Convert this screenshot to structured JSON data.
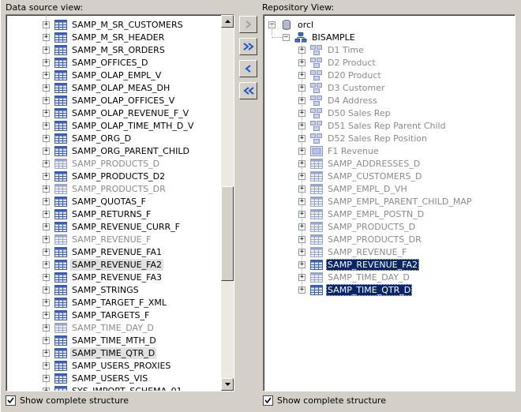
{
  "left_pane": {
    "title": "Data source view:",
    "items": [
      {
        "label": "SAMP_M_SR_CUSTOMERS",
        "style": "normal"
      },
      {
        "label": "SAMP_M_SR_HEADER",
        "style": "normal"
      },
      {
        "label": "SAMP_M_SR_ORDERS",
        "style": "normal"
      },
      {
        "label": "SAMP_OFFICES_D",
        "style": "normal"
      },
      {
        "label": "SAMP_OLAP_EMPL_V",
        "style": "normal"
      },
      {
        "label": "SAMP_OLAP_MEAS_DH",
        "style": "normal"
      },
      {
        "label": "SAMP_OLAP_OFFICES_V",
        "style": "normal"
      },
      {
        "label": "SAMP_OLAP_REVENUE_F_V",
        "style": "normal"
      },
      {
        "label": "SAMP_OLAP_TIME_MTH_D_V",
        "style": "normal"
      },
      {
        "label": "SAMP_ORG_D",
        "style": "normal"
      },
      {
        "label": "SAMP_ORG_PARENT_CHILD",
        "style": "normal"
      },
      {
        "label": "SAMP_PRODUCTS_D",
        "style": "dim"
      },
      {
        "label": "SAMP_PRODUCTS_D2",
        "style": "normal"
      },
      {
        "label": "SAMP_PRODUCTS_DR",
        "style": "dim"
      },
      {
        "label": "SAMP_QUOTAS_F",
        "style": "normal"
      },
      {
        "label": "SAMP_RETURNS_F",
        "style": "normal"
      },
      {
        "label": "SAMP_REVENUE_CURR_F",
        "style": "normal"
      },
      {
        "label": "SAMP_REVENUE_F",
        "style": "dim"
      },
      {
        "label": "SAMP_REVENUE_FA1",
        "style": "normal"
      },
      {
        "label": "SAMP_REVENUE_FA2",
        "style": "sel-grey"
      },
      {
        "label": "SAMP_REVENUE_FA3",
        "style": "normal"
      },
      {
        "label": "SAMP_STRINGS",
        "style": "normal"
      },
      {
        "label": "SAMP_TARGET_F_XML",
        "style": "normal"
      },
      {
        "label": "SAMP_TARGETS_F",
        "style": "normal"
      },
      {
        "label": "SAMP_TIME_DAY_D",
        "style": "dim"
      },
      {
        "label": "SAMP_TIME_MTH_D",
        "style": "normal"
      },
      {
        "label": "SAMP_TIME_QTR_D",
        "style": "sel-grey"
      },
      {
        "label": "SAMP_USERS_PROXIES",
        "style": "normal"
      },
      {
        "label": "SAMP_USERS_VIS",
        "style": "normal"
      },
      {
        "label": "SYS_IMPORT_SCHEMA_01",
        "style": "normal"
      }
    ],
    "scroll_position": 0.62
  },
  "right_pane": {
    "title": "Repository View:",
    "root": {
      "label": "orcl",
      "icon": "database-icon"
    },
    "schema": {
      "label": "BISAMPLE",
      "icon": "schema-icon"
    },
    "items": [
      {
        "label": "D1 Time",
        "style": "dim",
        "icon": "dimension-icon"
      },
      {
        "label": "D2 Product",
        "style": "dim",
        "icon": "dimension-icon"
      },
      {
        "label": "D20 Product",
        "style": "dim",
        "icon": "dimension-icon"
      },
      {
        "label": "D3 Customer",
        "style": "dim",
        "icon": "dimension-icon"
      },
      {
        "label": "D4 Address",
        "style": "dim",
        "icon": "dimension-icon"
      },
      {
        "label": "D50 Sales Rep",
        "style": "dim",
        "icon": "dimension-icon"
      },
      {
        "label": "D51 Sales Rep Parent Child",
        "style": "dim",
        "icon": "dimension-icon"
      },
      {
        "label": "D52 Sales Rep Position",
        "style": "dim",
        "icon": "dimension-icon"
      },
      {
        "label": "F1 Revenue",
        "style": "dim",
        "icon": "fact-icon"
      },
      {
        "label": "SAMP_ADDRESSES_D",
        "style": "dim",
        "icon": "table-icon"
      },
      {
        "label": "SAMP_CUSTOMERS_D",
        "style": "dim",
        "icon": "table-icon"
      },
      {
        "label": "SAMP_EMPL_D_VH",
        "style": "dim",
        "icon": "table-icon"
      },
      {
        "label": "SAMP_EMPL_PARENT_CHILD_MAP",
        "style": "dim",
        "icon": "table-icon"
      },
      {
        "label": "SAMP_EMPL_POSTN_D",
        "style": "dim",
        "icon": "table-icon"
      },
      {
        "label": "SAMP_PRODUCTS_D",
        "style": "dim",
        "icon": "table-icon"
      },
      {
        "label": "SAMP_PRODUCTS_DR",
        "style": "dim",
        "icon": "table-icon"
      },
      {
        "label": "SAMP_REVENUE_F",
        "style": "dim",
        "icon": "table-icon"
      },
      {
        "label": "SAMP_REVENUE_FA2",
        "style": "sel-blue",
        "icon": "table-icon"
      },
      {
        "label": "SAMP_TIME_DAY_D",
        "style": "dim",
        "icon": "table-icon"
      },
      {
        "label": "SAMP_TIME_QTR_D",
        "style": "sel-blue",
        "icon": "table-icon"
      }
    ]
  },
  "buttons": {
    "add": {
      "icon": "chevron-right-icon",
      "enabled": false
    },
    "add_all": {
      "icon": "double-chevron-right-icon",
      "enabled": true
    },
    "remove": {
      "icon": "chevron-left-icon",
      "enabled": true
    },
    "remove_all": {
      "icon": "double-chevron-left-icon",
      "enabled": true
    }
  },
  "left_checkbox": {
    "label": "Show complete structure",
    "checked": true
  },
  "right_checkbox": {
    "label": "Show complete structure",
    "checked": true
  },
  "colors": {
    "selection_blue": "#0a246a",
    "selection_grey": "#e1e1e1",
    "dim_text": "#8a8a8a",
    "table_icon_blue": "#3b5fb5"
  }
}
